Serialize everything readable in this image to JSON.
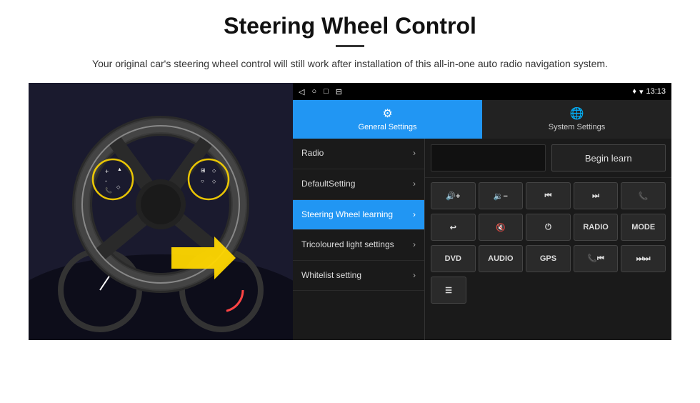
{
  "header": {
    "title": "Steering Wheel Control",
    "subtitle": "Your original car's steering wheel control will still work after installation of this all-in-one auto radio navigation system."
  },
  "statusBar": {
    "navIcons": [
      "◁",
      "○",
      "□",
      "⊟"
    ],
    "rightIcons": "♦ ▾ 13:13"
  },
  "tabs": [
    {
      "id": "general",
      "label": "General Settings",
      "icon": "⚙",
      "active": true
    },
    {
      "id": "system",
      "label": "System Settings",
      "icon": "🌐",
      "active": false
    }
  ],
  "menuItems": [
    {
      "id": "radio",
      "label": "Radio",
      "active": false
    },
    {
      "id": "defaultsetting",
      "label": "DefaultSetting",
      "active": false
    },
    {
      "id": "swlearning",
      "label": "Steering Wheel learning",
      "active": true
    },
    {
      "id": "tricoloured",
      "label": "Tricoloured light settings",
      "active": false
    },
    {
      "id": "whitelist",
      "label": "Whitelist setting",
      "active": false
    }
  ],
  "controlPanel": {
    "beginLearnLabel": "Begin learn",
    "row1Buttons": [
      {
        "id": "vol-up",
        "label": "🔊+"
      },
      {
        "id": "vol-down",
        "label": "🔉-"
      },
      {
        "id": "prev-track",
        "label": "⏮"
      },
      {
        "id": "next-track",
        "label": "⏭"
      },
      {
        "id": "phone",
        "label": "📞"
      }
    ],
    "row2Buttons": [
      {
        "id": "hook",
        "label": "↩"
      },
      {
        "id": "mute",
        "label": "🔇"
      },
      {
        "id": "power",
        "label": "⏻"
      },
      {
        "id": "radio",
        "label": "RADIO"
      },
      {
        "id": "mode",
        "label": "MODE"
      }
    ],
    "row3Buttons": [
      {
        "id": "dvd",
        "label": "DVD"
      },
      {
        "id": "audio",
        "label": "AUDIO"
      },
      {
        "id": "gps",
        "label": "GPS"
      },
      {
        "id": "phone-prev",
        "label": "📞⏮"
      },
      {
        "id": "skip-next",
        "label": "⏭⏭"
      }
    ],
    "row4Buttons": [
      {
        "id": "list",
        "label": "☰"
      }
    ]
  }
}
